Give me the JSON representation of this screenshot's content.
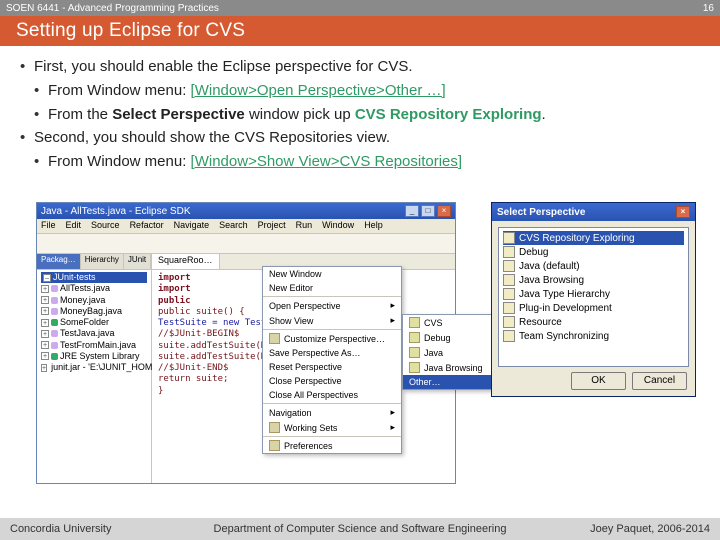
{
  "topbar": {
    "left": "SOEN 6441 - Advanced Programming Practices",
    "right": "16"
  },
  "title": "Setting up Eclipse for CVS",
  "bullets": {
    "b1a": "First, you should enable the Eclipse perspective for CVS.",
    "b2a_pre": "From Window menu: ",
    "b2a_link": "[Window>Open Perspective>Other …]",
    "b2b_pre": "From the ",
    "b2b_bold1": "Select Perspective",
    "b2b_mid": " window pick up ",
    "b2b_bold2": "CVS Repository Exploring",
    "b2b_end": ".",
    "b1b": "Second, you should show the CVS Repositories view.",
    "b2c_pre": "From Window menu:  ",
    "b2c_link": "[Window>Show View>CVS Repositories]"
  },
  "eclipse": {
    "title": "Java - AllTests.java - Eclipse SDK",
    "menu": [
      "File",
      "Edit",
      "Source",
      "Refactor",
      "Navigate",
      "Search",
      "Project",
      "Run",
      "Window",
      "Help"
    ],
    "sideTabs": [
      "Packag…",
      "Hierarchy",
      "JUnit"
    ],
    "root": "JUnit-tests",
    "tree": [
      "AllTests.java",
      "Money.java",
      "MoneyBag.java",
      "SomeFolder",
      "TestJava.java",
      "TestFromMain.java",
      "JRE System Library",
      "junit.jar - 'E:\\JUNIT_HOME' - 'D:\\eclipse\\pl…'"
    ],
    "mainTab": "SquareRoo…",
    "code": [
      "import",
      "import ",
      "",
      "public",
      "",
      "   public suite() {",
      "     TestSuite = new TestSuite(\"Test…",
      "     //$JUnit-BEGIN$",
      "     suite.addTestSuite(Money.class);",
      "     suite.addTestSuite(MoneyBag.class);",
      "     //$JUnit-END$",
      "     return suite;",
      "   }"
    ],
    "dropdown": [
      "New Window",
      "New Editor",
      "Open Perspective",
      "Show View",
      "Customize Perspective…",
      "Save Perspective As…",
      "Reset Perspective",
      "Close Perspective",
      "Close All Perspectives",
      "Navigation",
      "Working Sets",
      "Preferences"
    ],
    "submenu": [
      "CVS",
      "Debug",
      "Java",
      "Java Browsing",
      "Other…"
    ]
  },
  "dialog": {
    "title": "Select Perspective",
    "items": [
      "CVS Repository Exploring",
      "Debug",
      "Java (default)",
      "Java Browsing",
      "Java Type Hierarchy",
      "Plug-in Development",
      "Resource",
      "Team Synchronizing"
    ],
    "ok": "OK",
    "cancel": "Cancel"
  },
  "footer": {
    "left": "Concordia University",
    "mid": "Department of Computer Science and Software Engineering",
    "right": "Joey Paquet, 2006-2014"
  }
}
